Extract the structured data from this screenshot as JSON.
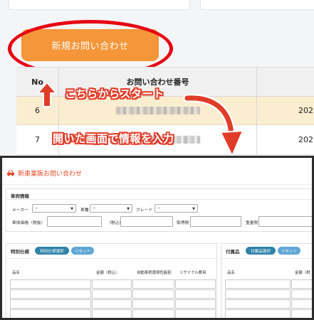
{
  "portal": {
    "new_inquiry_button": "新規お問い合わせ",
    "table": {
      "headers": {
        "no": "No",
        "inquiry_number": "お問い合わせ番号"
      },
      "rows": [
        {
          "no": "6",
          "date": "202"
        },
        {
          "no": "7",
          "date": "202"
        }
      ]
    }
  },
  "annotations": {
    "start_here": "こちらからスタート",
    "enter_info": "開いた画面で情報を入力",
    "accent_color": "#e60012",
    "callout_outline_color": "#e03c28"
  },
  "form": {
    "title": "新車業販お問い合わせ",
    "title_icon": "car-icon",
    "vehicle_section": {
      "heading": "車両情報",
      "maker_label": "メーカー",
      "maker_value": "--",
      "car_model_label": "車種",
      "car_model_value": "--",
      "grade_label": "グレード",
      "grade_value": "--",
      "body_price_label": "車体価格（税抜）",
      "tax_label": "（税込）",
      "acquisition_tax_label": "取得税",
      "weight_tax_label": "重量税"
    },
    "options_section": {
      "heading": "特別仕様",
      "select_button": "特別仕様選択",
      "reset_button": "リセット",
      "columns": [
        "品名",
        "金額（税込）",
        "自動車税環境性能割",
        "リサイクル費用"
      ]
    },
    "accessories_section": {
      "heading": "付属品",
      "select_button": "付属品選択",
      "reset_button": "リセット",
      "columns": [
        "品名",
        "金額（税"
      ]
    }
  }
}
